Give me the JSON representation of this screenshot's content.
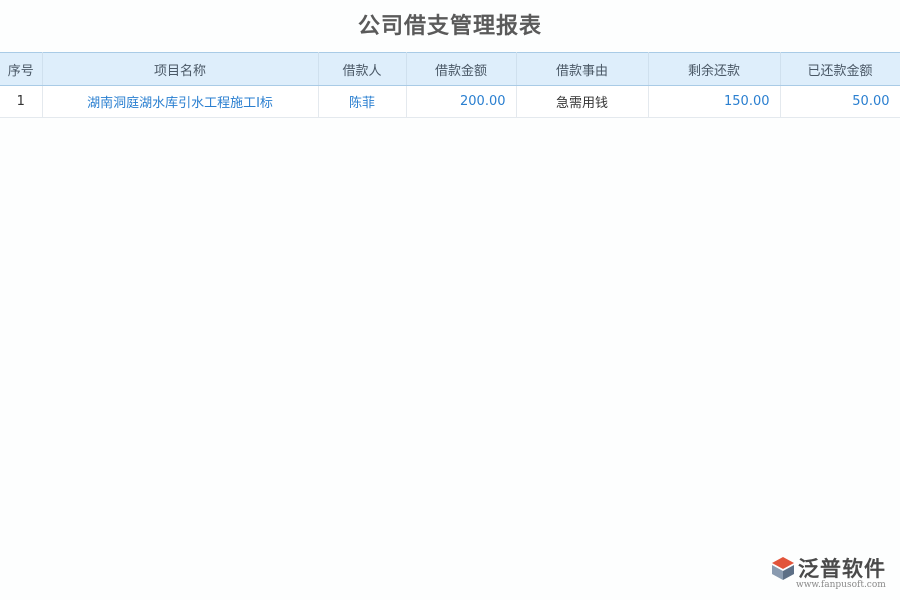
{
  "page": {
    "title": "公司借支管理报表"
  },
  "table": {
    "columns": [
      "序号",
      "项目名称",
      "借款人",
      "借款金额",
      "借款事由",
      "剩余还款",
      "已还款金额"
    ],
    "rows": [
      {
        "index": "1",
        "project": "湖南洞庭湖水库引水工程施工I标",
        "borrower": "陈菲",
        "amount": "200.00",
        "reason": "急需用钱",
        "remaining": "150.00",
        "repaid": "50.00"
      }
    ]
  },
  "colors": {
    "header_bg": "#deeefb",
    "link": "#2a7fd0",
    "title": "#5a5a5a"
  },
  "brand": {
    "name": "泛普软件",
    "url": "www.fanpusoft.com"
  }
}
